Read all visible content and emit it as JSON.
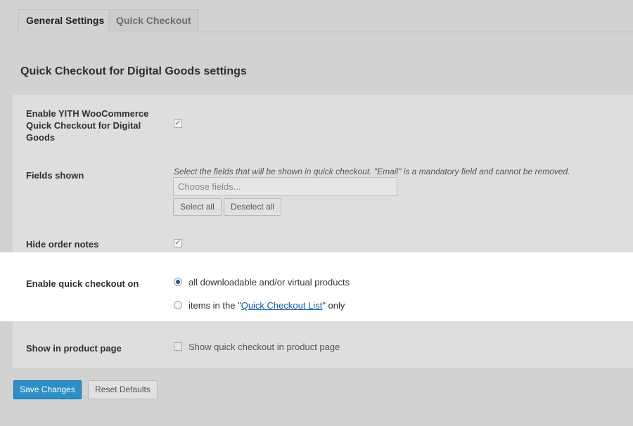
{
  "tabs": [
    {
      "label": "General Settings",
      "active": true
    },
    {
      "label": "Quick Checkout",
      "active": false
    }
  ],
  "section_title": "Quick Checkout for Digital Goods settings",
  "settings": {
    "enable": {
      "label_lines": [
        "Enable YITH WooCommerce",
        "Quick Checkout for Digital",
        "Goods"
      ],
      "checked": true
    },
    "fields_shown": {
      "label": "Fields shown",
      "description": "Select the fields that will be shown in quick checkout. \"Email\" is a mandatory field and cannot be removed.",
      "placeholder": "Choose fields...",
      "select_all": "Select all",
      "deselect_all": "Deselect all"
    },
    "hide_order_notes": {
      "label": "Hide order notes",
      "checked": true
    },
    "enable_on": {
      "label": "Enable quick checkout on",
      "options": [
        {
          "text": "all downloadable and/or virtual products",
          "selected": true
        },
        {
          "prefix": "items in the \"",
          "link": "Quick Checkout List",
          "suffix": "\" only",
          "selected": false
        }
      ]
    },
    "show_in_product_page": {
      "label": "Show in product page",
      "option_label": "Show quick checkout in product page",
      "checked": false
    }
  },
  "buttons": {
    "save": "Save Changes",
    "reset": "Reset Defaults"
  },
  "colors": {
    "background": "#d2d2d2",
    "highlight": "#ffffff",
    "primary": "#2e8fc7",
    "link": "#0f5b9f"
  }
}
